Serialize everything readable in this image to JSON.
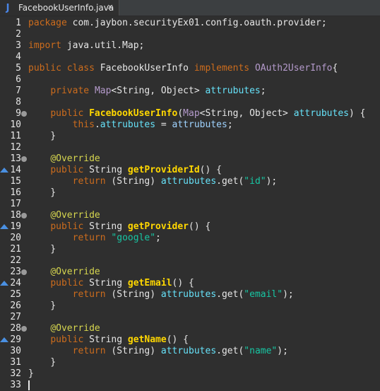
{
  "tab": {
    "icon": "J",
    "title": "FacebookUserInfo.java",
    "close": "×"
  },
  "lines": [
    "1",
    "2",
    "3",
    "4",
    "5",
    "6",
    "7",
    "8",
    "9",
    "10",
    "11",
    "12",
    "13",
    "14",
    "15",
    "16",
    "17",
    "18",
    "19",
    "20",
    "21",
    "22",
    "23",
    "24",
    "25",
    "26",
    "27",
    "28",
    "29",
    "30",
    "31",
    "32",
    "33"
  ],
  "code": [
    [
      [
        "kw",
        "package"
      ],
      [
        "plain",
        " com.jaybon.securityEx01.config.oauth.provider;"
      ]
    ],
    [],
    [
      [
        "kw",
        "import"
      ],
      [
        "plain",
        " java.util.Map;"
      ]
    ],
    [],
    [
      [
        "kw",
        "public"
      ],
      [
        "plain",
        " "
      ],
      [
        "kw",
        "class"
      ],
      [
        "plain",
        " FacebookUserInfo "
      ],
      [
        "kw",
        "implements"
      ],
      [
        "plain",
        " "
      ],
      [
        "ty",
        "OAuth2UserInfo"
      ],
      [
        "plain",
        "{"
      ]
    ],
    [],
    [
      [
        "plain",
        "    "
      ],
      [
        "kw",
        "private"
      ],
      [
        "plain",
        " "
      ],
      [
        "ty",
        "Map"
      ],
      [
        "plain",
        "<String, Object> "
      ],
      [
        "field",
        "attrubutes"
      ],
      [
        "plain",
        ";"
      ]
    ],
    [],
    [
      [
        "plain",
        "    "
      ],
      [
        "kw",
        "public"
      ],
      [
        "plain",
        " "
      ],
      [
        "fn",
        "FacebookUserInfo"
      ],
      [
        "plain",
        "("
      ],
      [
        "ty",
        "Map"
      ],
      [
        "plain",
        "<String, Object> "
      ],
      [
        "field",
        "attrubutes"
      ],
      [
        "plain",
        ") {"
      ]
    ],
    [
      [
        "plain",
        "        "
      ],
      [
        "kw",
        "this"
      ],
      [
        "plain",
        "."
      ],
      [
        "field",
        "attrubutes"
      ],
      [
        "plain",
        " = "
      ],
      [
        "fld2",
        "attrubutes"
      ],
      [
        "plain",
        ";"
      ]
    ],
    [
      [
        "plain",
        "    }"
      ]
    ],
    [],
    [
      [
        "plain",
        "    "
      ],
      [
        "ann",
        "@Override"
      ]
    ],
    [
      [
        "plain",
        "    "
      ],
      [
        "kw",
        "public"
      ],
      [
        "plain",
        " String "
      ],
      [
        "fn",
        "getProviderId"
      ],
      [
        "plain",
        "() {"
      ]
    ],
    [
      [
        "plain",
        "        "
      ],
      [
        "kw",
        "return"
      ],
      [
        "plain",
        " (String) "
      ],
      [
        "field",
        "attrubutes"
      ],
      [
        "plain",
        ".get("
      ],
      [
        "str",
        "\"id\""
      ],
      [
        "plain",
        ");"
      ]
    ],
    [
      [
        "plain",
        "    }"
      ]
    ],
    [],
    [
      [
        "plain",
        "    "
      ],
      [
        "ann",
        "@Override"
      ]
    ],
    [
      [
        "plain",
        "    "
      ],
      [
        "kw",
        "public"
      ],
      [
        "plain",
        " String "
      ],
      [
        "fn",
        "getProvider"
      ],
      [
        "plain",
        "() {"
      ]
    ],
    [
      [
        "plain",
        "        "
      ],
      [
        "kw",
        "return"
      ],
      [
        "plain",
        " "
      ],
      [
        "str",
        "\"google\""
      ],
      [
        "plain",
        ";"
      ]
    ],
    [
      [
        "plain",
        "    }"
      ]
    ],
    [],
    [
      [
        "plain",
        "    "
      ],
      [
        "ann",
        "@Override"
      ]
    ],
    [
      [
        "plain",
        "    "
      ],
      [
        "kw",
        "public"
      ],
      [
        "plain",
        " String "
      ],
      [
        "fn",
        "getEmail"
      ],
      [
        "plain",
        "() {"
      ]
    ],
    [
      [
        "plain",
        "        "
      ],
      [
        "kw",
        "return"
      ],
      [
        "plain",
        " (String) "
      ],
      [
        "field",
        "attrubutes"
      ],
      [
        "plain",
        ".get("
      ],
      [
        "str",
        "\"email\""
      ],
      [
        "plain",
        ");"
      ]
    ],
    [
      [
        "plain",
        "    }"
      ]
    ],
    [],
    [
      [
        "plain",
        "    "
      ],
      [
        "ann",
        "@Override"
      ]
    ],
    [
      [
        "plain",
        "    "
      ],
      [
        "kw",
        "public"
      ],
      [
        "plain",
        " String "
      ],
      [
        "fn",
        "getName"
      ],
      [
        "plain",
        "() {"
      ]
    ],
    [
      [
        "plain",
        "        "
      ],
      [
        "kw",
        "return"
      ],
      [
        "plain",
        " (String) "
      ],
      [
        "field",
        "attrubutes"
      ],
      [
        "plain",
        ".get("
      ],
      [
        "str",
        "\"name\""
      ],
      [
        "plain",
        ");"
      ]
    ],
    [
      [
        "plain",
        "    }"
      ]
    ],
    [
      [
        "plain",
        "}"
      ]
    ],
    []
  ],
  "fold_lines": [
    9,
    13,
    18,
    23,
    28
  ],
  "override_marker_lines": [
    14,
    19,
    24,
    29
  ]
}
